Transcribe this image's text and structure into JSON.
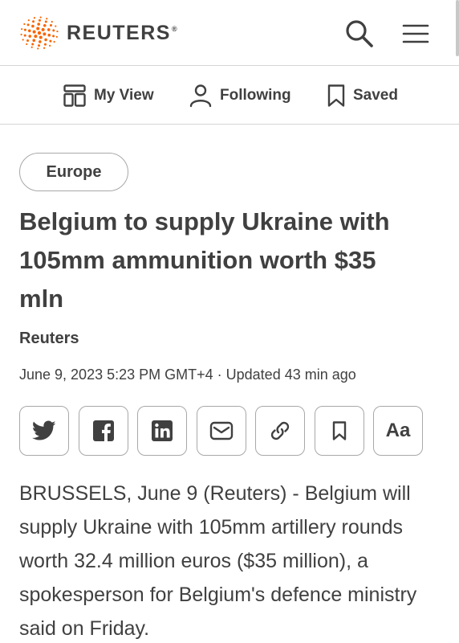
{
  "header": {
    "logo_text": "REUTERS",
    "logo_mark": "®",
    "search_icon": "search-icon",
    "menu_icon": "hamburger-menu-icon"
  },
  "nav": {
    "items": [
      {
        "label": "My View",
        "icon": "my-view-icon"
      },
      {
        "label": "Following",
        "icon": "person-icon"
      },
      {
        "label": "Saved",
        "icon": "bookmark-icon"
      }
    ]
  },
  "article": {
    "category": "Europe",
    "headline": "Belgium to supply Ukraine with 105mm ammunition worth $35 mln",
    "byline": "Reuters",
    "date": "June 9, 2023 5:23 PM GMT+4",
    "updated": "· Updated 43 min ago",
    "share_buttons": [
      {
        "icon": "twitter-icon"
      },
      {
        "icon": "facebook-icon"
      },
      {
        "icon": "linkedin-icon"
      },
      {
        "icon": "email-icon"
      },
      {
        "icon": "link-icon"
      },
      {
        "icon": "bookmark-icon"
      },
      {
        "icon": "text-size-icon",
        "label": "Aa"
      }
    ],
    "body": "BRUSSELS, June 9 (Reuters) - Belgium will supply Ukraine with 105mm artillery rounds worth 32.4 million euros ($35 million), a spokesperson for Belgium's defence ministry said on Friday."
  },
  "colors": {
    "brand_orange": "#fa6400",
    "text": "#404040",
    "border": "#a8a8a8",
    "divider": "#d6d6d6"
  }
}
